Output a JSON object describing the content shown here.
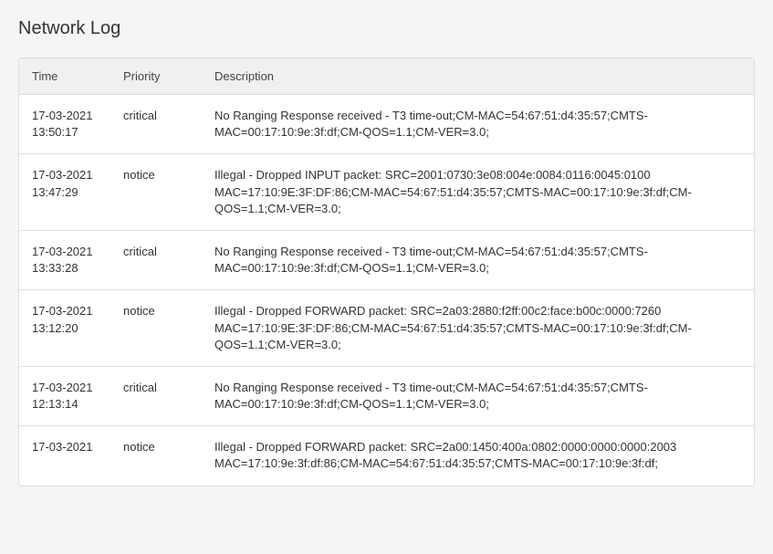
{
  "page": {
    "title": "Network Log"
  },
  "table": {
    "columns": [
      {
        "key": "time",
        "label": "Time"
      },
      {
        "key": "priority",
        "label": "Priority"
      },
      {
        "key": "description",
        "label": "Description"
      }
    ],
    "rows": [
      {
        "time": "17-03-2021 13:50:17",
        "priority": "critical",
        "description": "No Ranging Response received - T3 time-out;CM-MAC=54:67:51:d4:35:57;CMTS-MAC=00:17:10:9e:3f:df;CM-QOS=1.1;CM-VER=3.0;"
      },
      {
        "time": "17-03-2021 13:47:29",
        "priority": "notice",
        "description": "Illegal - Dropped INPUT packet: SRC=2001:0730:3e08:004e:0084:0116:0045:0100 MAC=17:10:9E:3F:DF:86;CM-MAC=54:67:51:d4:35:57;CMTS-MAC=00:17:10:9e:3f:df;CM-QOS=1.1;CM-VER=3.0;"
      },
      {
        "time": "17-03-2021 13:33:28",
        "priority": "critical",
        "description": "No Ranging Response received - T3 time-out;CM-MAC=54:67:51:d4:35:57;CMTS-MAC=00:17:10:9e:3f:df;CM-QOS=1.1;CM-VER=3.0;"
      },
      {
        "time": "17-03-2021 13:12:20",
        "priority": "notice",
        "description": "Illegal - Dropped FORWARD packet: SRC=2a03:2880:f2ff:00c2:face:b00c:0000:7260 MAC=17:10:9E:3F:DF:86;CM-MAC=54:67:51:d4:35:57;CMTS-MAC=00:17:10:9e:3f:df;CM-QOS=1.1;CM-VER=3.0;"
      },
      {
        "time": "17-03-2021 12:13:14",
        "priority": "critical",
        "description": "No Ranging Response received - T3 time-out;CM-MAC=54:67:51:d4:35:57;CMTS-MAC=00:17:10:9e:3f:df;CM-QOS=1.1;CM-VER=3.0;"
      },
      {
        "time": "17-03-2021",
        "priority": "notice",
        "description": "Illegal - Dropped FORWARD packet: SRC=2a00:1450:400a:0802:0000:0000:0000:2003 MAC=17:10:9e:3f:df:86;CM-MAC=54:67:51:d4:35:57;CMTS-MAC=00:17:10:9e:3f:df;"
      }
    ]
  }
}
